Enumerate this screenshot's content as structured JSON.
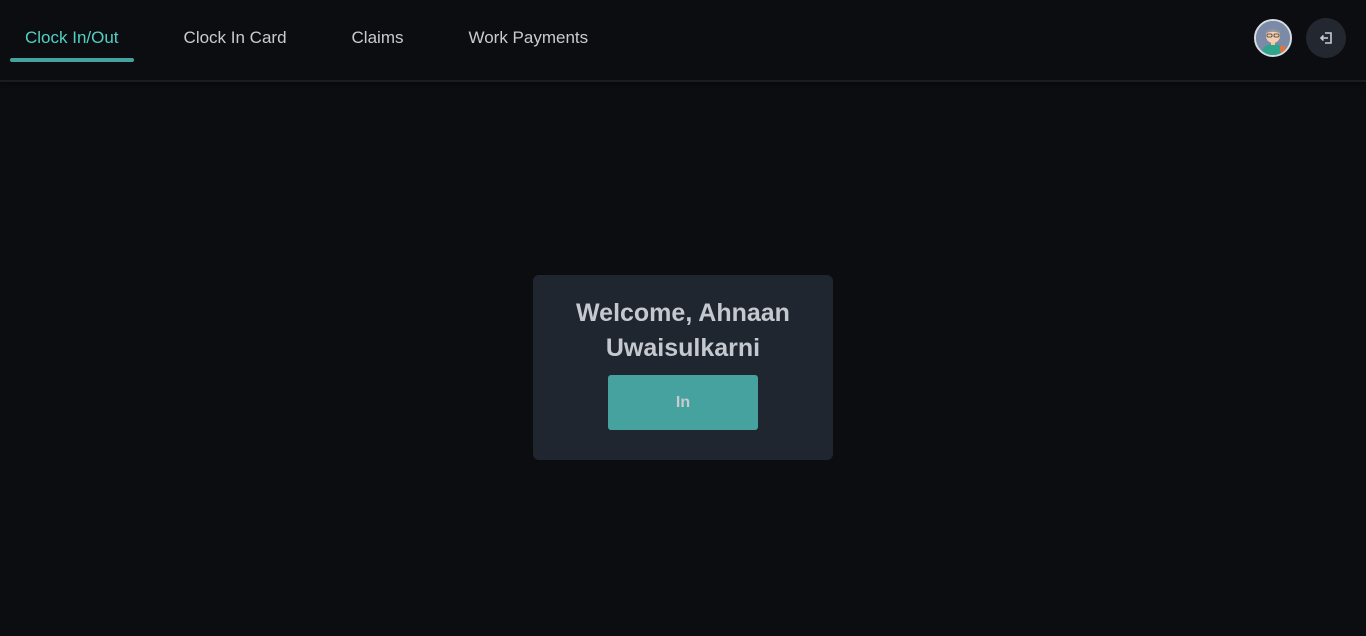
{
  "nav": {
    "tabs": [
      {
        "label": "Clock In/Out",
        "active": true
      },
      {
        "label": "Clock In Card",
        "active": false
      },
      {
        "label": "Claims",
        "active": false
      },
      {
        "label": "Work Payments",
        "active": false
      }
    ]
  },
  "header": {
    "avatar_icon": "user-avatar",
    "logout_icon": "logout-icon"
  },
  "main": {
    "welcome_text": "Welcome, Ahnaan Uwaisulkarni",
    "clock_button_label": "In"
  },
  "colors": {
    "background": "#0c0d10",
    "accent": "#45a29e",
    "active_tab_text": "#4fd1c5",
    "card_background": "#1f2630"
  }
}
